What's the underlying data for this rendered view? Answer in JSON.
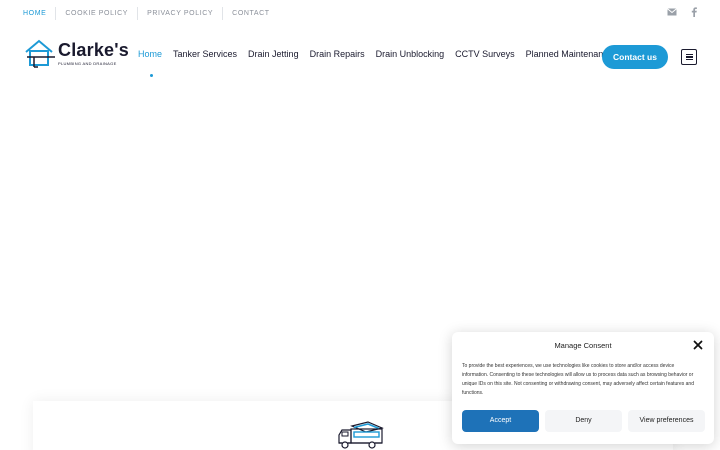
{
  "topbar": {
    "links": [
      "HOME",
      "COOKIE POLICY",
      "PRIVACY POLICY",
      "CONTACT"
    ]
  },
  "logo": {
    "name": "Clarke's",
    "tagline": "PLUMBING AND DRAINAGE"
  },
  "nav": {
    "items": [
      "Home",
      "Tanker Services",
      "Drain Jetting",
      "Drain Repairs",
      "Drain Unblocking",
      "CCTV Surveys",
      "Planned Maintenance"
    ],
    "active": "Home"
  },
  "header": {
    "contact_label": "Contact us"
  },
  "consent": {
    "title": "Manage Consent",
    "body": "To provide the best experiences, we use technologies like cookies to store and/or access device information. Consenting to these technologies will allow us to process data such as browsing behavior or unique IDs on this site. Not consenting or withdrawing consent, may adversely affect certain features and functions.",
    "accept_label": "Accept",
    "deny_label": "Deny",
    "prefs_label": "View preferences"
  },
  "colors": {
    "accent": "#1d9ad6",
    "accept_button": "#1e72b8",
    "text_dark": "#1a1a2e"
  },
  "icons": {
    "top_right": [
      "envelope-icon",
      "facebook-icon"
    ],
    "header": "hamburger-menu-icon",
    "card": "truck-icon",
    "consent": "close-icon"
  }
}
